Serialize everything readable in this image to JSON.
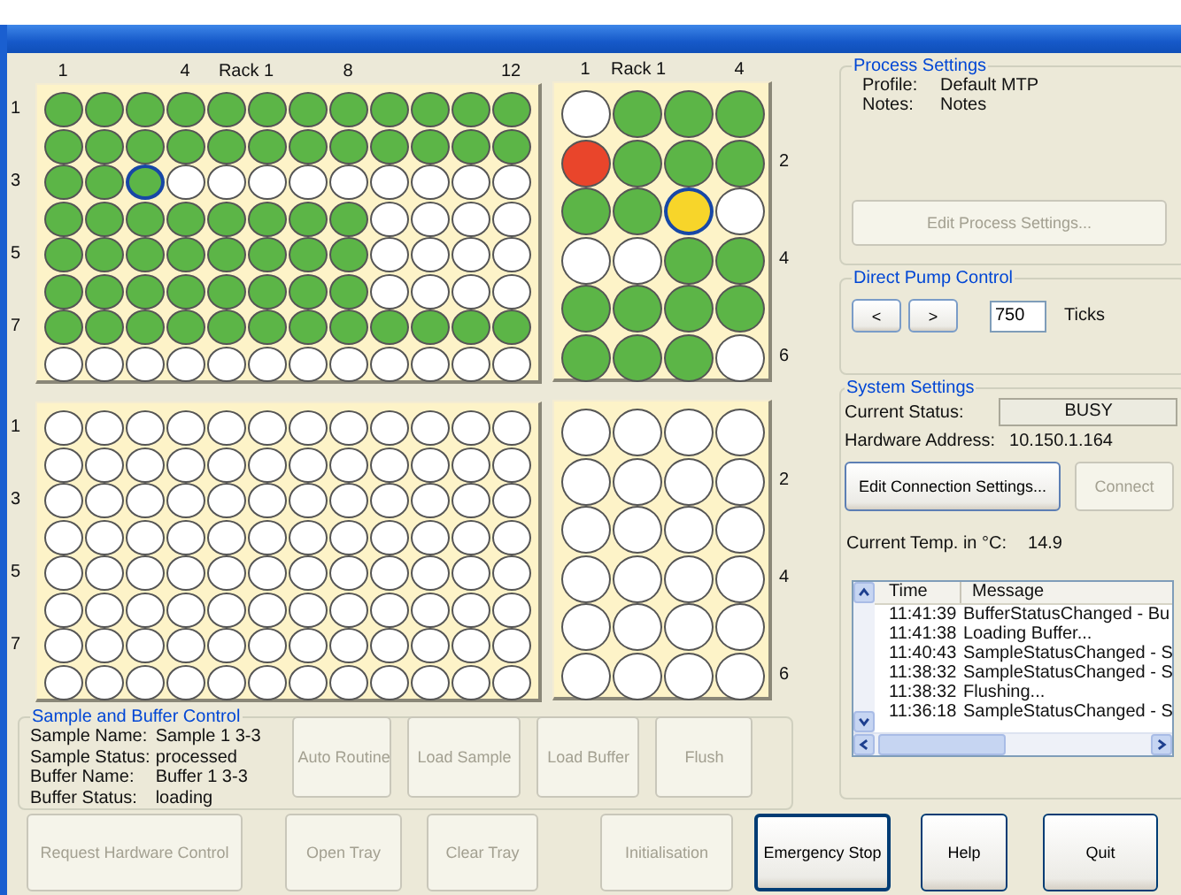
{
  "plates": [
    {
      "kind": "large",
      "column_labels": [
        "1",
        "4",
        "Rack 1",
        "8",
        "12"
      ],
      "row_labels": [
        "1",
        "3",
        "5",
        "7"
      ],
      "wells": [
        [
          {
            "kind": "done"
          },
          {
            "kind": "done"
          },
          {
            "kind": "done"
          },
          {
            "kind": "done"
          },
          {
            "kind": "done"
          },
          {
            "kind": "done"
          },
          {
            "kind": "done"
          },
          {
            "kind": "done"
          },
          {
            "kind": "done"
          },
          {
            "kind": "done"
          },
          {
            "kind": "done"
          },
          {
            "kind": "done"
          }
        ],
        [
          {
            "kind": "done"
          },
          {
            "kind": "done"
          },
          {
            "kind": "done"
          },
          {
            "kind": "done"
          },
          {
            "kind": "done"
          },
          {
            "kind": "done"
          },
          {
            "kind": "done"
          },
          {
            "kind": "done"
          },
          {
            "kind": "done"
          },
          {
            "kind": "done"
          },
          {
            "kind": "done"
          },
          {
            "kind": "done"
          }
        ],
        [
          {
            "kind": "done"
          },
          {
            "kind": "done"
          },
          {
            "kind": "current"
          },
          {
            "kind": "empty"
          },
          {
            "kind": "empty"
          },
          {
            "kind": "empty"
          },
          {
            "kind": "empty"
          },
          {
            "kind": "empty"
          },
          {
            "kind": "empty"
          },
          {
            "kind": "empty"
          },
          {
            "kind": "empty"
          },
          {
            "kind": "empty"
          }
        ],
        [
          {
            "kind": "done"
          },
          {
            "kind": "done"
          },
          {
            "kind": "done"
          },
          {
            "kind": "done"
          },
          {
            "kind": "done"
          },
          {
            "kind": "done"
          },
          {
            "kind": "done"
          },
          {
            "kind": "done"
          },
          {
            "kind": "empty"
          },
          {
            "kind": "empty"
          },
          {
            "kind": "empty"
          },
          {
            "kind": "empty"
          }
        ],
        [
          {
            "kind": "done"
          },
          {
            "kind": "done"
          },
          {
            "kind": "done"
          },
          {
            "kind": "done"
          },
          {
            "kind": "done"
          },
          {
            "kind": "done"
          },
          {
            "kind": "done"
          },
          {
            "kind": "done"
          },
          {
            "kind": "empty"
          },
          {
            "kind": "empty"
          },
          {
            "kind": "empty"
          },
          {
            "kind": "empty"
          }
        ],
        [
          {
            "kind": "done"
          },
          {
            "kind": "done"
          },
          {
            "kind": "done"
          },
          {
            "kind": "done"
          },
          {
            "kind": "done"
          },
          {
            "kind": "done"
          },
          {
            "kind": "done"
          },
          {
            "kind": "done"
          },
          {
            "kind": "empty"
          },
          {
            "kind": "empty"
          },
          {
            "kind": "empty"
          },
          {
            "kind": "empty"
          }
        ],
        [
          {
            "kind": "done"
          },
          {
            "kind": "done"
          },
          {
            "kind": "done"
          },
          {
            "kind": "done"
          },
          {
            "kind": "done"
          },
          {
            "kind": "done"
          },
          {
            "kind": "done"
          },
          {
            "kind": "done"
          },
          {
            "kind": "done"
          },
          {
            "kind": "done"
          },
          {
            "kind": "done"
          },
          {
            "kind": "done"
          }
        ],
        [
          {
            "kind": "empty"
          },
          {
            "kind": "empty"
          },
          {
            "kind": "empty"
          },
          {
            "kind": "empty"
          },
          {
            "kind": "empty"
          },
          {
            "kind": "empty"
          },
          {
            "kind": "empty"
          },
          {
            "kind": "empty"
          },
          {
            "kind": "empty"
          },
          {
            "kind": "empty"
          },
          {
            "kind": "empty"
          },
          {
            "kind": "empty"
          }
        ]
      ]
    },
    {
      "kind": "small",
      "column_labels": [
        "1",
        "Rack 1",
        "4"
      ],
      "row_labels": [
        "2",
        "4",
        "6"
      ],
      "wells": [
        [
          {
            "kind": "empty"
          },
          {
            "kind": "done"
          },
          {
            "kind": "done"
          },
          {
            "kind": "done"
          }
        ],
        [
          {
            "kind": "failed"
          },
          {
            "kind": "done"
          },
          {
            "kind": "done"
          },
          {
            "kind": "done"
          }
        ],
        [
          {
            "kind": "done"
          },
          {
            "kind": "done"
          },
          {
            "kind": "running"
          },
          {
            "kind": "empty"
          }
        ],
        [
          {
            "kind": "empty"
          },
          {
            "kind": "empty"
          },
          {
            "kind": "done"
          },
          {
            "kind": "done"
          }
        ],
        [
          {
            "kind": "done"
          },
          {
            "kind": "done"
          },
          {
            "kind": "done"
          },
          {
            "kind": "done"
          }
        ],
        [
          {
            "kind": "done"
          },
          {
            "kind": "done"
          },
          {
            "kind": "done"
          },
          {
            "kind": "empty"
          }
        ]
      ]
    },
    {
      "kind": "large",
      "row_labels": [
        "1",
        "3",
        "5",
        "7"
      ],
      "wells": [
        [
          {
            "kind": "empty"
          },
          {
            "kind": "empty"
          },
          {
            "kind": "empty"
          },
          {
            "kind": "empty"
          },
          {
            "kind": "empty"
          },
          {
            "kind": "empty"
          },
          {
            "kind": "empty"
          },
          {
            "kind": "empty"
          },
          {
            "kind": "empty"
          },
          {
            "kind": "empty"
          },
          {
            "kind": "empty"
          },
          {
            "kind": "empty"
          }
        ],
        [
          {
            "kind": "empty"
          },
          {
            "kind": "empty"
          },
          {
            "kind": "empty"
          },
          {
            "kind": "empty"
          },
          {
            "kind": "empty"
          },
          {
            "kind": "empty"
          },
          {
            "kind": "empty"
          },
          {
            "kind": "empty"
          },
          {
            "kind": "empty"
          },
          {
            "kind": "empty"
          },
          {
            "kind": "empty"
          },
          {
            "kind": "empty"
          }
        ],
        [
          {
            "kind": "empty"
          },
          {
            "kind": "empty"
          },
          {
            "kind": "empty"
          },
          {
            "kind": "empty"
          },
          {
            "kind": "empty"
          },
          {
            "kind": "empty"
          },
          {
            "kind": "empty"
          },
          {
            "kind": "empty"
          },
          {
            "kind": "empty"
          },
          {
            "kind": "empty"
          },
          {
            "kind": "empty"
          },
          {
            "kind": "empty"
          }
        ],
        [
          {
            "kind": "empty"
          },
          {
            "kind": "empty"
          },
          {
            "kind": "empty"
          },
          {
            "kind": "empty"
          },
          {
            "kind": "empty"
          },
          {
            "kind": "empty"
          },
          {
            "kind": "empty"
          },
          {
            "kind": "empty"
          },
          {
            "kind": "empty"
          },
          {
            "kind": "empty"
          },
          {
            "kind": "empty"
          },
          {
            "kind": "empty"
          }
        ],
        [
          {
            "kind": "empty"
          },
          {
            "kind": "empty"
          },
          {
            "kind": "empty"
          },
          {
            "kind": "empty"
          },
          {
            "kind": "empty"
          },
          {
            "kind": "empty"
          },
          {
            "kind": "empty"
          },
          {
            "kind": "empty"
          },
          {
            "kind": "empty"
          },
          {
            "kind": "empty"
          },
          {
            "kind": "empty"
          },
          {
            "kind": "empty"
          }
        ],
        [
          {
            "kind": "empty"
          },
          {
            "kind": "empty"
          },
          {
            "kind": "empty"
          },
          {
            "kind": "empty"
          },
          {
            "kind": "empty"
          },
          {
            "kind": "empty"
          },
          {
            "kind": "empty"
          },
          {
            "kind": "empty"
          },
          {
            "kind": "empty"
          },
          {
            "kind": "empty"
          },
          {
            "kind": "empty"
          },
          {
            "kind": "empty"
          }
        ],
        [
          {
            "kind": "empty"
          },
          {
            "kind": "empty"
          },
          {
            "kind": "empty"
          },
          {
            "kind": "empty"
          },
          {
            "kind": "empty"
          },
          {
            "kind": "empty"
          },
          {
            "kind": "empty"
          },
          {
            "kind": "empty"
          },
          {
            "kind": "empty"
          },
          {
            "kind": "empty"
          },
          {
            "kind": "empty"
          },
          {
            "kind": "empty"
          }
        ],
        [
          {
            "kind": "empty"
          },
          {
            "kind": "empty"
          },
          {
            "kind": "empty"
          },
          {
            "kind": "empty"
          },
          {
            "kind": "empty"
          },
          {
            "kind": "empty"
          },
          {
            "kind": "empty"
          },
          {
            "kind": "empty"
          },
          {
            "kind": "empty"
          },
          {
            "kind": "empty"
          },
          {
            "kind": "empty"
          },
          {
            "kind": "empty"
          }
        ]
      ]
    },
    {
      "kind": "small",
      "row_labels": [
        "2",
        "4",
        "6"
      ],
      "wells": [
        [
          {
            "kind": "empty"
          },
          {
            "kind": "empty"
          },
          {
            "kind": "empty"
          },
          {
            "kind": "empty"
          }
        ],
        [
          {
            "kind": "empty"
          },
          {
            "kind": "empty"
          },
          {
            "kind": "empty"
          },
          {
            "kind": "empty"
          }
        ],
        [
          {
            "kind": "empty"
          },
          {
            "kind": "empty"
          },
          {
            "kind": "empty"
          },
          {
            "kind": "empty"
          }
        ],
        [
          {
            "kind": "empty"
          },
          {
            "kind": "empty"
          },
          {
            "kind": "empty"
          },
          {
            "kind": "empty"
          }
        ],
        [
          {
            "kind": "empty"
          },
          {
            "kind": "empty"
          },
          {
            "kind": "empty"
          },
          {
            "kind": "empty"
          }
        ],
        [
          {
            "kind": "empty"
          },
          {
            "kind": "empty"
          },
          {
            "kind": "empty"
          },
          {
            "kind": "empty"
          }
        ]
      ]
    }
  ],
  "sample_buffer_control": {
    "title": "Sample and Buffer Control",
    "fields": [
      {
        "label": "Sample Name:",
        "value": "Sample 1 3-3"
      },
      {
        "label": "Sample Status:",
        "value": "processed"
      },
      {
        "label": "Buffer Name:",
        "value": "Buffer 1 3-3"
      },
      {
        "label": "Buffer Status:",
        "value": "loading"
      }
    ],
    "buttons": [
      {
        "label": "Auto Routine",
        "disabled": true
      },
      {
        "label": "Load Sample",
        "disabled": true
      },
      {
        "label": "Load Buffer",
        "disabled": true
      },
      {
        "label": "Flush",
        "disabled": true
      }
    ]
  },
  "process_settings": {
    "title": "Process Settings",
    "fields": [
      {
        "label": "Profile:",
        "value": "Default MTP"
      },
      {
        "label": "Notes:",
        "value": "Notes"
      }
    ],
    "button": {
      "label": "Edit Process Settings...",
      "disabled": true
    }
  },
  "direct_pump_control": {
    "title": "Direct Pump Control",
    "back_button": "<",
    "forward_button": ">",
    "value": "750",
    "unit": "Ticks"
  },
  "system_settings": {
    "title": "System Settings",
    "status_label": "Current Status:",
    "status": "BUSY",
    "address_label": "Hardware Address:",
    "address": "10.150.1.164",
    "buttons": [
      {
        "label": "Edit Connection Settings...",
        "disabled": false
      },
      {
        "label": "Connect",
        "disabled": true
      }
    ],
    "temp_label": "Current Temp. in °C:",
    "temp": "14.9",
    "log": {
      "columns": [
        "Time",
        "Message"
      ],
      "rows": [
        {
          "time": "11:41:39",
          "message": "BufferStatusChanged - Bu"
        },
        {
          "time": "11:41:38",
          "message": "Loading Buffer..."
        },
        {
          "time": "11:40:43",
          "message": "SampleStatusChanged - S"
        },
        {
          "time": "11:38:32",
          "message": "SampleStatusChanged - S"
        },
        {
          "time": "11:38:32",
          "message": "Flushing..."
        },
        {
          "time": "11:36:18",
          "message": "SampleStatusChanged - S"
        }
      ]
    }
  },
  "bottom_buttons": [
    {
      "label": "Request Hardware Control",
      "disabled": true
    },
    {
      "label": "Open Tray",
      "disabled": true
    },
    {
      "label": "Clear Tray",
      "disabled": true
    },
    {
      "label": "Initialisation",
      "disabled": true
    },
    {
      "label": "Emergency Stop",
      "disabled": false
    },
    {
      "label": "Help",
      "disabled": false
    },
    {
      "label": "Quit",
      "disabled": false
    }
  ]
}
